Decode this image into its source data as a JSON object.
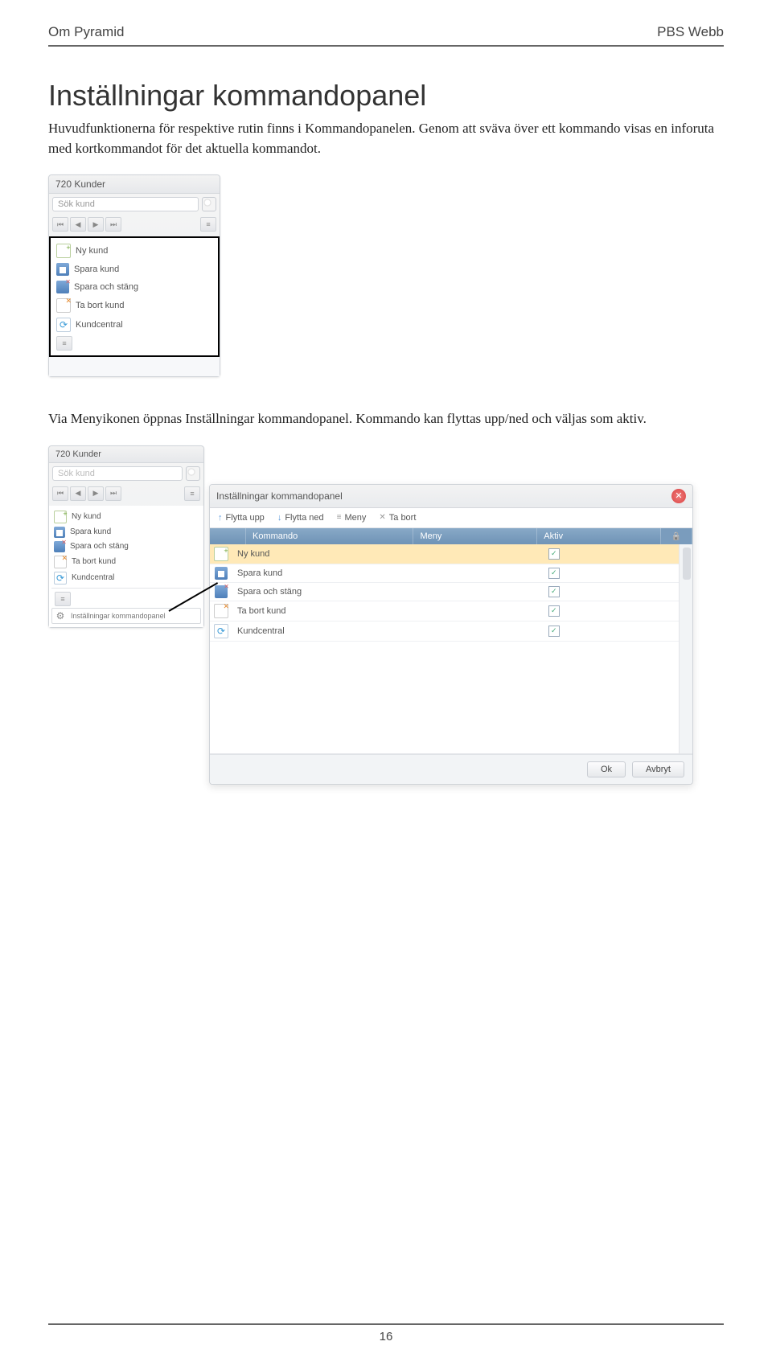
{
  "header": {
    "left": "Om Pyramid",
    "right": "PBS Webb"
  },
  "heading": "Inställningar kommandopanel",
  "para1": "Huvudfunktionerna för respektive rutin finns i Kommandopanelen. Genom att sväva över ett kommando visas en inforuta med kortkommandot för det aktuella kommandot.",
  "para2": "Via Menyikonen öppnas Inställningar kommandopanel. Kommando kan flyttas upp/ned och väljas som aktiv.",
  "panel1": {
    "title": "720 Kunder",
    "search_placeholder": "Sök kund",
    "items": [
      "Ny kund",
      "Spara kund",
      "Spara och stäng",
      "Ta bort kund",
      "Kundcentral"
    ]
  },
  "panel2": {
    "title": "720 Kunder",
    "search_placeholder": "Sök kund",
    "items": [
      "Ny kund",
      "Spara kund",
      "Spara och stäng",
      "Ta bort kund",
      "Kundcentral"
    ],
    "settings_item": "Inställningar kommandopanel"
  },
  "dialog": {
    "title": "Inställningar kommandopanel",
    "tools": {
      "up": "Flytta upp",
      "down": "Flytta ned",
      "menu": "Meny",
      "del": "Ta bort"
    },
    "columns": {
      "c1": "Kommando",
      "c2": "Meny",
      "c3": "Aktiv"
    },
    "rows": [
      {
        "label": "Ny kund",
        "active": true,
        "icon": "new"
      },
      {
        "label": "Spara kund",
        "active": true,
        "icon": "save"
      },
      {
        "label": "Spara och stäng",
        "active": true,
        "icon": "saveclose"
      },
      {
        "label": "Ta bort kund",
        "active": true,
        "icon": "delete"
      },
      {
        "label": "Kundcentral",
        "active": true,
        "icon": "kc"
      }
    ],
    "ok": "Ok",
    "cancel": "Avbryt"
  },
  "pagenum": "16"
}
